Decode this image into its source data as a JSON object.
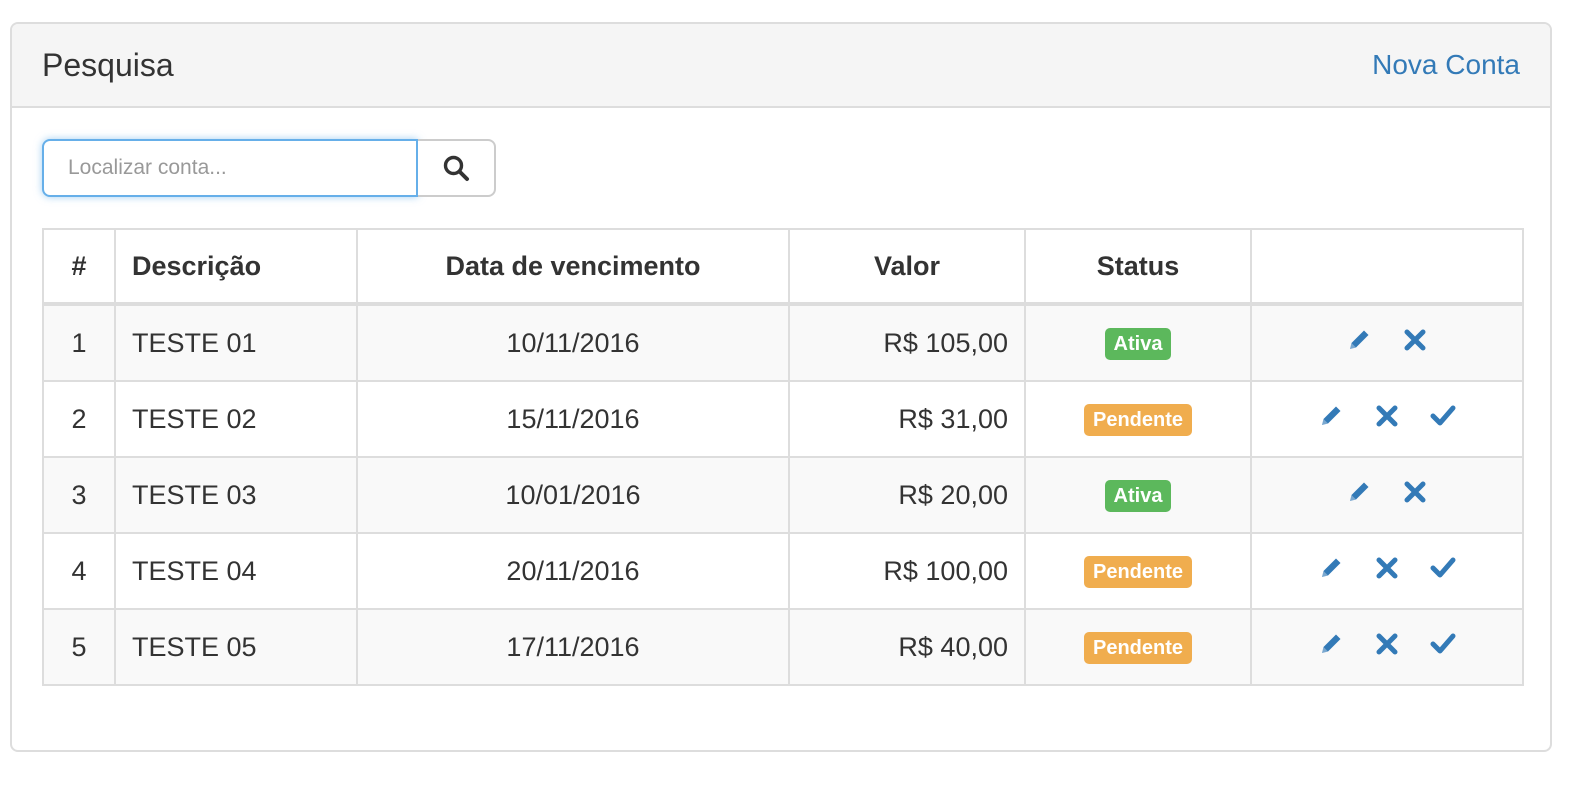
{
  "panel": {
    "title": "Pesquisa",
    "new_link": "Nova Conta"
  },
  "search": {
    "placeholder": "Localizar conta...",
    "icon": "search-icon"
  },
  "table": {
    "headers": [
      "#",
      "Descrição",
      "Data de vencimento",
      "Valor",
      "Status",
      ""
    ],
    "rows": [
      {
        "id": "1",
        "descricao": "TESTE 01",
        "data": "10/11/2016",
        "valor": "R$ 105,00",
        "status": "Ativa",
        "actions": [
          "edit",
          "delete"
        ]
      },
      {
        "id": "2",
        "descricao": "TESTE 02",
        "data": "15/11/2016",
        "valor": "R$ 31,00",
        "status": "Pendente",
        "actions": [
          "edit",
          "delete",
          "confirm"
        ]
      },
      {
        "id": "3",
        "descricao": "TESTE 03",
        "data": "10/01/2016",
        "valor": "R$ 20,00",
        "status": "Ativa",
        "actions": [
          "edit",
          "delete"
        ]
      },
      {
        "id": "4",
        "descricao": "TESTE 04",
        "data": "20/11/2016",
        "valor": "R$ 100,00",
        "status": "Pendente",
        "actions": [
          "edit",
          "delete",
          "confirm"
        ]
      },
      {
        "id": "5",
        "descricao": "TESTE 05",
        "data": "17/11/2016",
        "valor": "R$ 40,00",
        "status": "Pendente",
        "actions": [
          "edit",
          "delete",
          "confirm"
        ]
      }
    ]
  },
  "colors": {
    "link": "#337ab7",
    "status_ativa": "#5cb85c",
    "status_pendente": "#f0ad4e",
    "icon": "#337ab7"
  }
}
